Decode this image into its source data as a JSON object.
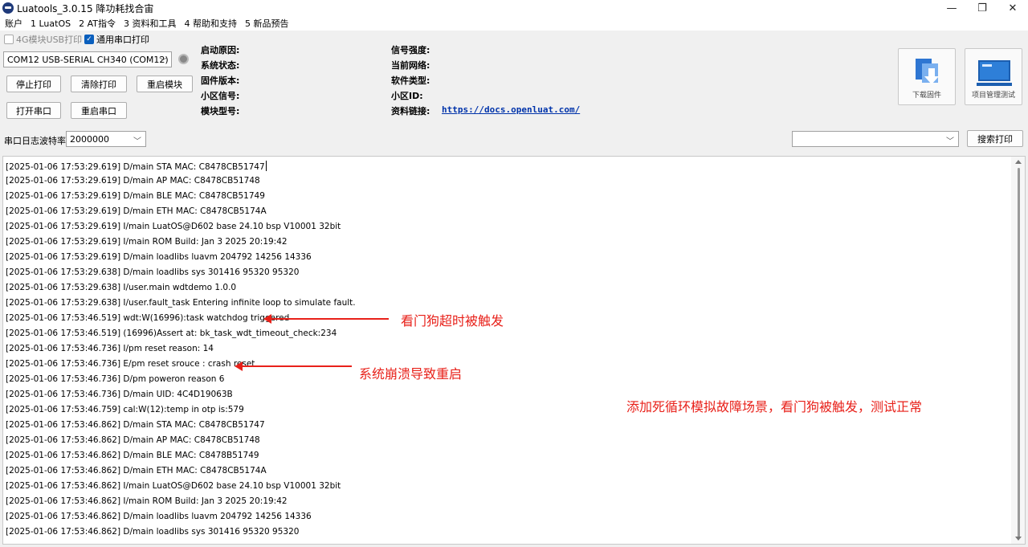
{
  "window": {
    "title": "Luatools_3.0.15 降功耗找合宙",
    "minimize": "—",
    "maximize": "❐",
    "close": "✕"
  },
  "menu": [
    "账户",
    "1 LuatOS",
    "2 AT指令",
    "3 资料和工具",
    "4 帮助和支持",
    "5 新品预告"
  ],
  "options": {
    "usb4g_print": "4G模块USB打印",
    "serial_print": "通用串口打印",
    "serial_print_checked": true,
    "usb4g_print_checked": false
  },
  "port": {
    "selected": "COM12 USB-SERIAL CH340 (COM12)"
  },
  "buttons": {
    "stop_print": "停止打印",
    "clear_print": "清除打印",
    "restart_module": "重启模块",
    "open_port": "打开串口",
    "restart_port": "重启串口",
    "search_print": "搜索打印",
    "download_firmware": "下载固件",
    "project_test": "项目管理测试"
  },
  "info_left": [
    "启动原因:",
    "系统状态:",
    "固件版本:",
    "小区信号:",
    "模块型号:"
  ],
  "info_right": [
    "信号强度:",
    "当前网络:",
    "软件类型:",
    "小区ID:",
    "资料链接:"
  ],
  "docs_link": "https://docs.openluat.com/",
  "baud": {
    "label": "串口日志波特率",
    "value": "2000000"
  },
  "search": {
    "value": ""
  },
  "log_lines": [
    "[2025-01-06 17:53:29.619] D/main STA MAC: C8478CB51747",
    "[2025-01-06 17:53:29.619] D/main AP  MAC: C8478CB51748",
    "[2025-01-06 17:53:29.619] D/main BLE MAC: C8478CB51749",
    "[2025-01-06 17:53:29.619] D/main ETH MAC: C8478CB5174A",
    "[2025-01-06 17:53:29.619] I/main LuatOS@D602 base 24.10 bsp V10001 32bit",
    "[2025-01-06 17:53:29.619] I/main ROM Build: Jan  3 2025 20:19:42",
    "[2025-01-06 17:53:29.619] D/main loadlibs luavm 204792 14256 14336",
    "[2025-01-06 17:53:29.638] D/main loadlibs sys   301416 95320 95320",
    "[2025-01-06 17:53:29.638] I/user.main      wdtdemo          1.0.0",
    "[2025-01-06 17:53:29.638] I/user.fault_task          Entering infinite loop to simulate fault.",
    "[2025-01-06 17:53:46.519] wdt:W(16996):task watchdog triggered",
    "[2025-01-06 17:53:46.519] (16996)Assert at: bk_task_wdt_timeout_check:234",
    "[2025-01-06 17:53:46.736] I/pm reset reason: 14",
    "[2025-01-06 17:53:46.736] E/pm reset srouce : crash reset",
    "[2025-01-06 17:53:46.736] D/pm poweron reason 6",
    "[2025-01-06 17:53:46.736] D/main UID: 4C4D19063B",
    "[2025-01-06 17:53:46.759] cal:W(12):temp in otp is:579",
    "[2025-01-06 17:53:46.862] D/main STA MAC: C8478CB51747",
    "[2025-01-06 17:53:46.862] D/main AP  MAC: C8478CB51748",
    "[2025-01-06 17:53:46.862] D/main BLE MAC: C8478B51749",
    "[2025-01-06 17:53:46.862] D/main ETH MAC: C8478CB5174A",
    "[2025-01-06 17:53:46.862] I/main LuatOS@D602 base 24.10 bsp V10001 32bit",
    "[2025-01-06 17:53:46.862] I/main ROM Build: Jan  3 2025 20:19:42",
    "[2025-01-06 17:53:46.862] D/main loadlibs luavm 204792 14256 14336",
    "[2025-01-06 17:53:46.862] D/main loadlibs sys   301416 95320 95320"
  ],
  "annotations": {
    "watchdog": "看门狗超时被触发",
    "crash": "系统崩溃导致重启",
    "summary": "添加死循环模拟故障场景，看门狗被触发，测试正常"
  },
  "colors": {
    "annotation": "#e8211a",
    "link": "#0033aa",
    "checkbox_checked": "#0a5fbd"
  },
  "icons": {
    "download_firmware": "download-firmware-icon",
    "project_test": "laptop-icon",
    "port_status": "status-dot-icon"
  }
}
